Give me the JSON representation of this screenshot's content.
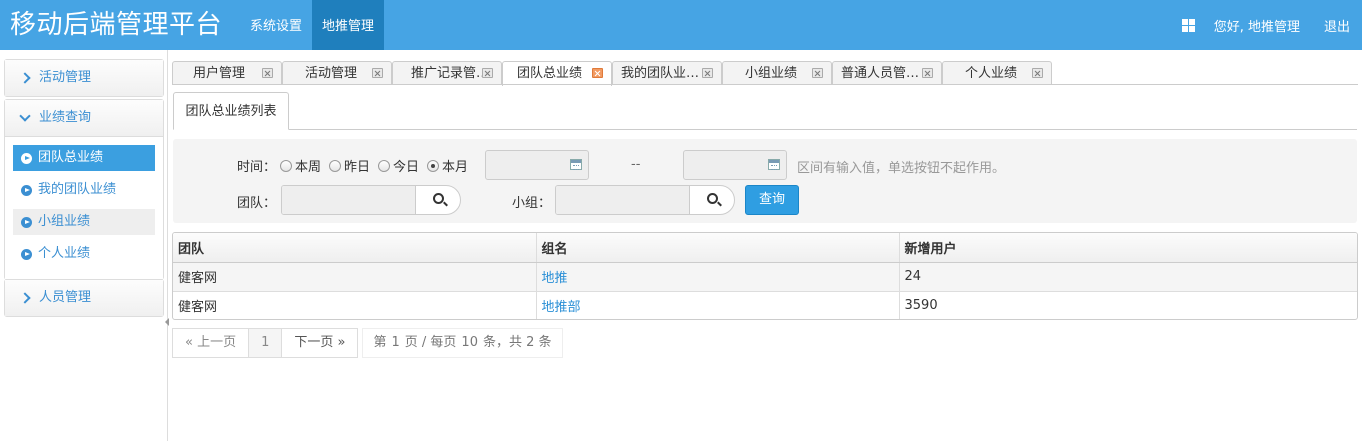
{
  "header": {
    "brand": "移动后端管理平台",
    "nav": [
      "系统设置",
      "地推管理"
    ],
    "greeting": "您好, 地推管理",
    "logout": "退出"
  },
  "sidebar": {
    "groups": [
      {
        "label": "活动管理"
      },
      {
        "label": "业绩查询",
        "items": [
          "团队总业绩",
          "我的团队业绩",
          "小组业绩",
          "个人业绩"
        ]
      },
      {
        "label": "人员管理"
      }
    ]
  },
  "tabs": [
    "用户管理",
    "活动管理",
    "推广记录管…",
    "团队总业绩",
    "我的团队业…",
    "小组业绩",
    "普通人员管…",
    "个人业绩"
  ],
  "panel": {
    "title": "团队总业绩列表"
  },
  "filter": {
    "time_label": "时间：",
    "radios": [
      "本周",
      "昨日",
      "今日",
      "本月"
    ],
    "range_sep": "--",
    "hint": "区间有输入值，单选按钮不起作用。",
    "team_label": "团队：",
    "group_label": "小组：",
    "query": "查询"
  },
  "table": {
    "headers": [
      "团队",
      "组名",
      "新增用户"
    ],
    "rows": [
      [
        "健客网",
        "地推",
        "24"
      ],
      [
        "健客网",
        "地推部",
        "3590"
      ]
    ]
  },
  "pager": {
    "prev": "« 上一页",
    "current": "1",
    "next": "下一页 »",
    "info_prefix": "第",
    "page": "1",
    "info_mid": "页 / 每页",
    "per_page": "10",
    "info_suffix": "条，共 2 条"
  },
  "colors": {
    "header": "#46a4e4",
    "nav_active": "#1f7fbd",
    "accent": "#3b9fe0",
    "link": "#2a8fd6"
  }
}
